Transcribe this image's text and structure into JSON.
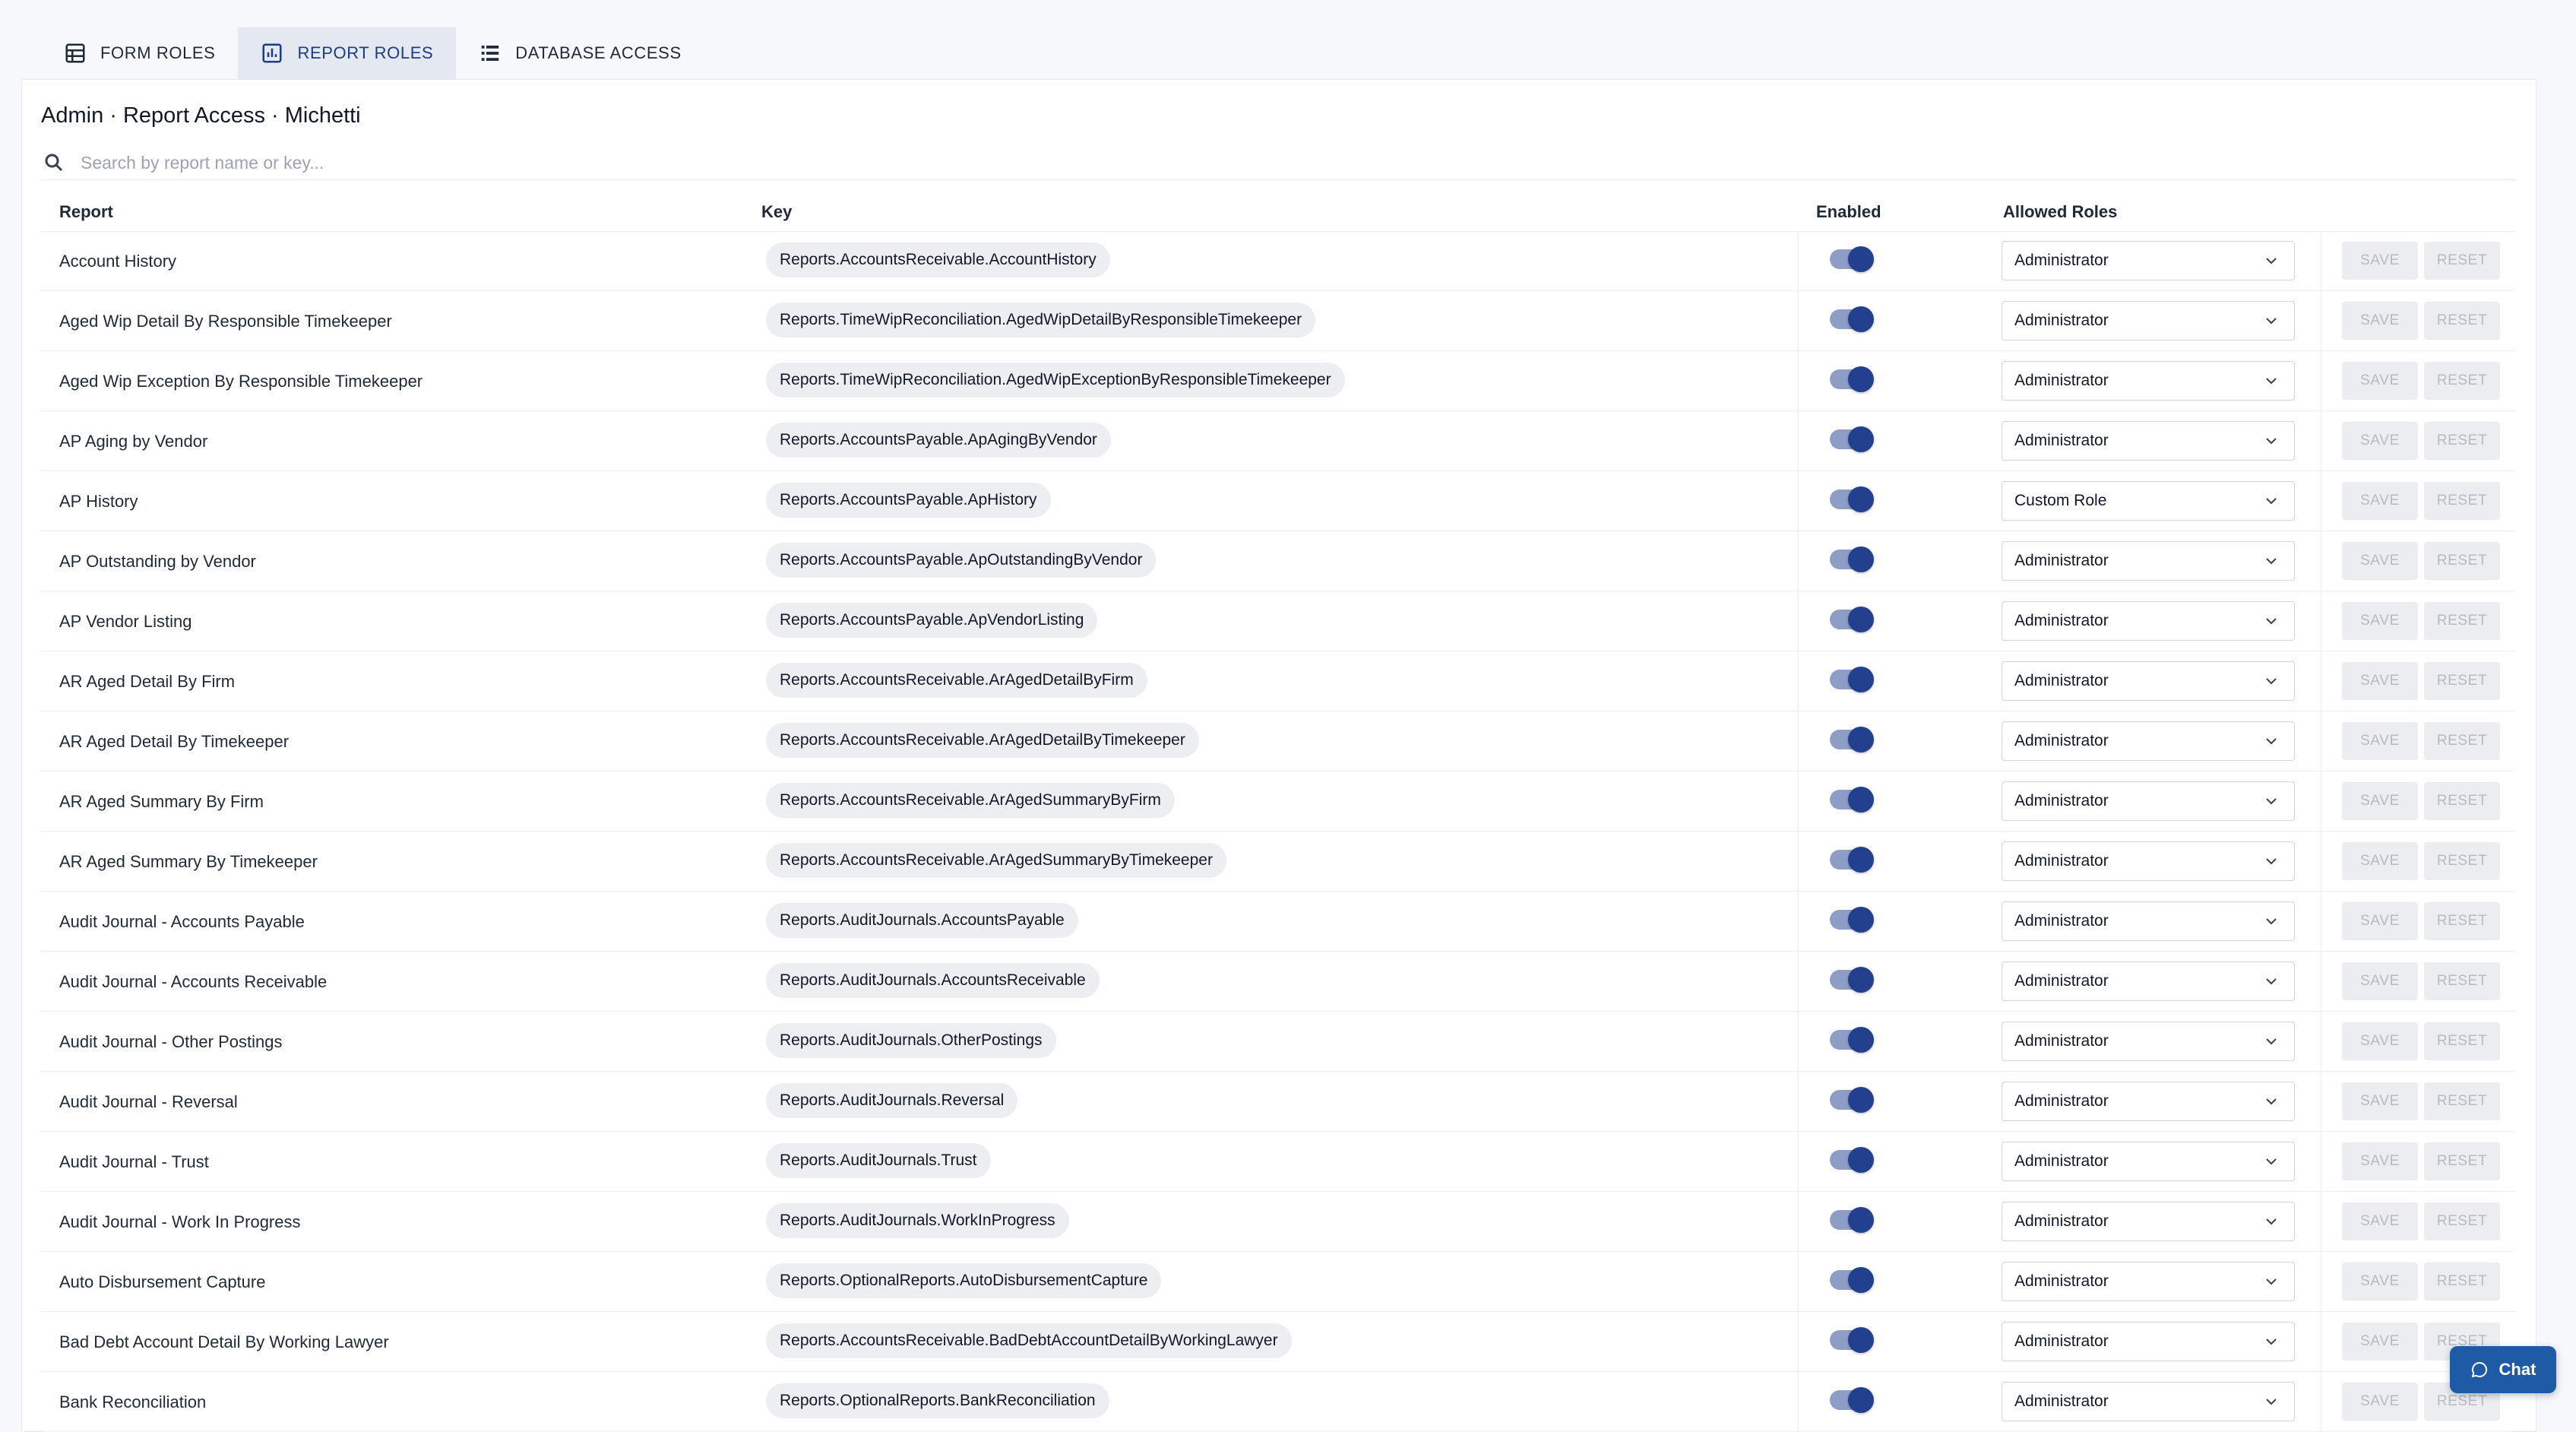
{
  "tabs": [
    {
      "label": "FORM ROLES",
      "icon": "table-icon",
      "active": false
    },
    {
      "label": "REPORT ROLES",
      "icon": "bar-chart-icon",
      "active": true
    },
    {
      "label": "DATABASE ACCESS",
      "icon": "list-icon",
      "active": false
    }
  ],
  "page": {
    "title": "Admin · Report Access · Michetti"
  },
  "search": {
    "placeholder": "Search by report name or key..."
  },
  "table": {
    "headers": {
      "report": "Report",
      "key": "Key",
      "enabled": "Enabled",
      "roles": "Allowed Roles"
    },
    "rows": [
      {
        "report": "Account History",
        "key": "Reports.AccountsReceivable.AccountHistory",
        "enabled": true,
        "role": "Administrator"
      },
      {
        "report": "Aged Wip Detail By Responsible Timekeeper",
        "key": "Reports.TimeWipReconciliation.AgedWipDetailByResponsibleTimekeeper",
        "enabled": true,
        "role": "Administrator"
      },
      {
        "report": "Aged Wip Exception By Responsible Timekeeper",
        "key": "Reports.TimeWipReconciliation.AgedWipExceptionByResponsibleTimekeeper",
        "enabled": true,
        "role": "Administrator"
      },
      {
        "report": "AP Aging by Vendor",
        "key": "Reports.AccountsPayable.ApAgingByVendor",
        "enabled": true,
        "role": "Administrator"
      },
      {
        "report": "AP History",
        "key": "Reports.AccountsPayable.ApHistory",
        "enabled": true,
        "role": "Custom Role"
      },
      {
        "report": "AP Outstanding by Vendor",
        "key": "Reports.AccountsPayable.ApOutstandingByVendor",
        "enabled": true,
        "role": "Administrator"
      },
      {
        "report": "AP Vendor Listing",
        "key": "Reports.AccountsPayable.ApVendorListing",
        "enabled": true,
        "role": "Administrator"
      },
      {
        "report": "AR Aged Detail By Firm",
        "key": "Reports.AccountsReceivable.ArAgedDetailByFirm",
        "enabled": true,
        "role": "Administrator"
      },
      {
        "report": "AR Aged Detail By Timekeeper",
        "key": "Reports.AccountsReceivable.ArAgedDetailByTimekeeper",
        "enabled": true,
        "role": "Administrator"
      },
      {
        "report": "AR Aged Summary By Firm",
        "key": "Reports.AccountsReceivable.ArAgedSummaryByFirm",
        "enabled": true,
        "role": "Administrator"
      },
      {
        "report": "AR Aged Summary By Timekeeper",
        "key": "Reports.AccountsReceivable.ArAgedSummaryByTimekeeper",
        "enabled": true,
        "role": "Administrator"
      },
      {
        "report": "Audit Journal - Accounts Payable",
        "key": "Reports.AuditJournals.AccountsPayable",
        "enabled": true,
        "role": "Administrator"
      },
      {
        "report": "Audit Journal - Accounts Receivable",
        "key": "Reports.AuditJournals.AccountsReceivable",
        "enabled": true,
        "role": "Administrator"
      },
      {
        "report": "Audit Journal - Other Postings",
        "key": "Reports.AuditJournals.OtherPostings",
        "enabled": true,
        "role": "Administrator"
      },
      {
        "report": "Audit Journal - Reversal",
        "key": "Reports.AuditJournals.Reversal",
        "enabled": true,
        "role": "Administrator"
      },
      {
        "report": "Audit Journal - Trust",
        "key": "Reports.AuditJournals.Trust",
        "enabled": true,
        "role": "Administrator"
      },
      {
        "report": "Audit Journal - Work In Progress",
        "key": "Reports.AuditJournals.WorkInProgress",
        "enabled": true,
        "role": "Administrator"
      },
      {
        "report": "Auto Disbursement Capture",
        "key": "Reports.OptionalReports.AutoDisbursementCapture",
        "enabled": true,
        "role": "Administrator"
      },
      {
        "report": "Bad Debt Account Detail By Working Lawyer",
        "key": "Reports.AccountsReceivable.BadDebtAccountDetailByWorkingLawyer",
        "enabled": true,
        "role": "Administrator"
      },
      {
        "report": "Bank Reconciliation",
        "key": "Reports.OptionalReports.BankReconciliation",
        "enabled": true,
        "role": "Administrator"
      }
    ]
  },
  "actions": {
    "save": "SAVE",
    "reset": "RESET"
  },
  "chat": {
    "label": "Chat"
  },
  "colors": {
    "accent": "#23408e",
    "toggle_track": "#8d9dc6",
    "chat": "#1f5aa6"
  }
}
